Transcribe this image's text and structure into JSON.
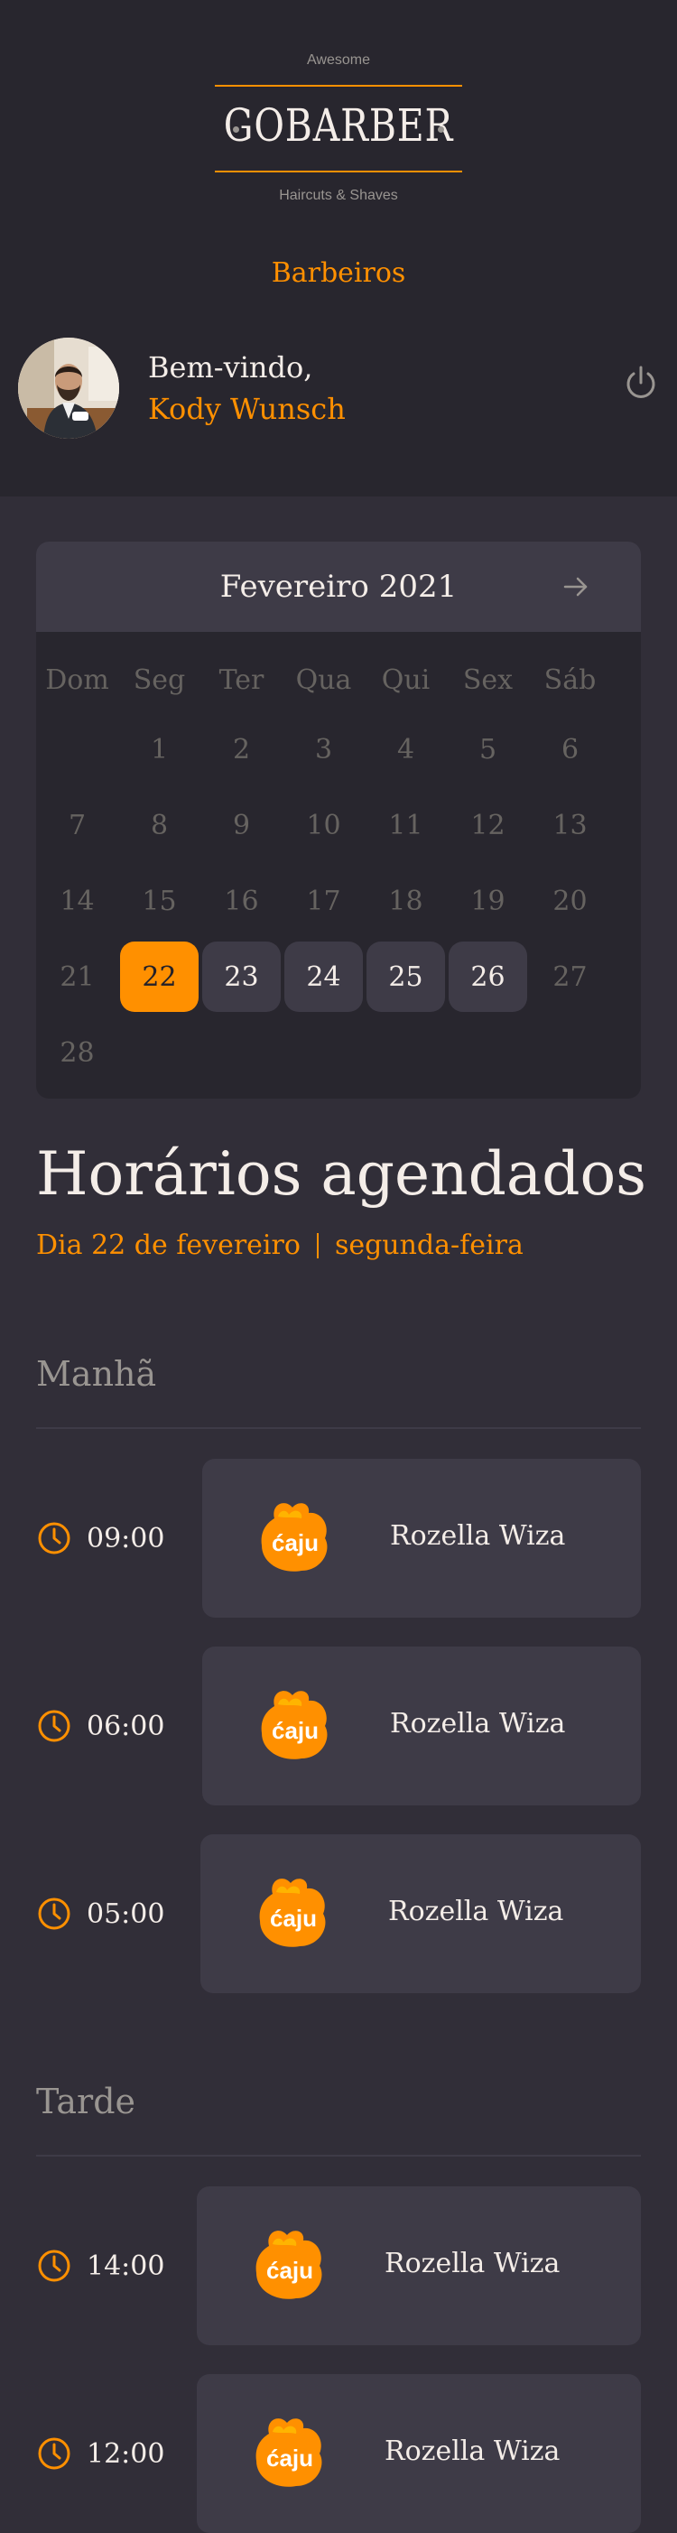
{
  "header": {
    "logo_top": "Awesome",
    "logo_word": "GOBARBER",
    "logo_bottom": "Haircuts & Shaves",
    "nav_link": "Barbeiros",
    "welcome": "Bem-vindo,",
    "username": "Kody Wunsch",
    "power_icon": "power-icon"
  },
  "calendar": {
    "title": "Fevereiro 2021",
    "next_icon": "arrow-right-icon",
    "weekdays": [
      "Dom",
      "Seg",
      "Ter",
      "Qua",
      "Qui",
      "Sex",
      "Sáb"
    ],
    "weeks": [
      [
        "",
        "1",
        "2",
        "3",
        "4",
        "5",
        "6"
      ],
      [
        "7",
        "8",
        "9",
        "10",
        "11",
        "12",
        "13"
      ],
      [
        "14",
        "15",
        "16",
        "17",
        "18",
        "19",
        "20"
      ],
      [
        "21",
        "22",
        "23",
        "24",
        "25",
        "26",
        "27"
      ],
      [
        "28",
        "",
        "",
        "",
        "",
        "",
        ""
      ]
    ],
    "selected_day": "22",
    "available_days": [
      "23",
      "24",
      "25",
      "26"
    ]
  },
  "schedule": {
    "title": "Horários agendados",
    "day": "Dia 22 de fevereiro",
    "weekday": "segunda-feira"
  },
  "morning": {
    "title": "Manhã",
    "appointments": [
      {
        "time": "09:00",
        "name": "Rozella Wiza",
        "logo_text": "ćaju"
      },
      {
        "time": "06:00",
        "name": "Rozella Wiza",
        "logo_text": "ćaju"
      },
      {
        "time": "05:00",
        "name": "Rozella Wiza",
        "logo_text": "ćaju"
      }
    ]
  },
  "afternoon": {
    "title": "Tarde",
    "appointments": [
      {
        "time": "14:00",
        "name": "Rozella Wiza",
        "logo_text": "ćaju"
      },
      {
        "time": "12:00",
        "name": "Rozella Wiza",
        "logo_text": "ćaju"
      }
    ]
  },
  "colors": {
    "accent": "#ff9000",
    "background": "#312e38",
    "header_bg": "#28262e",
    "card_bg": "#3e3b47",
    "muted": "#999591"
  }
}
